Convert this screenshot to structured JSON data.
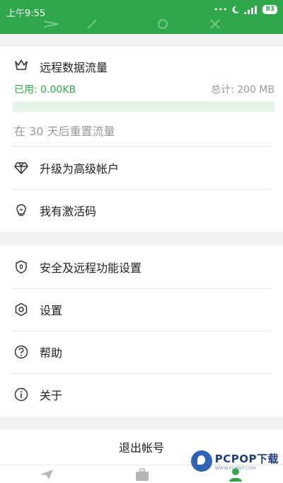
{
  "status_bar": {
    "time": "上午9:55",
    "battery": "83"
  },
  "traffic": {
    "title": "远程数据流量",
    "used": "已用: 0.00KB",
    "total": "总计: 200 MB",
    "used_fraction": 0.0,
    "reset_text": "在 30 天后重置流量"
  },
  "menu_group1": [
    {
      "label": "升级为高级帐户",
      "icon": "diamond-icon"
    },
    {
      "label": "我有激活码",
      "icon": "lightbulb-icon"
    }
  ],
  "menu_group2": [
    {
      "label": "安全及远程功能设置",
      "icon": "shield-icon"
    },
    {
      "label": "设置",
      "icon": "hexagon-settings-icon"
    },
    {
      "label": "帮助",
      "icon": "question-icon"
    },
    {
      "label": "关于",
      "icon": "info-icon"
    }
  ],
  "logout_label": "退出帐号",
  "watermark": {
    "brand": "PCPOP下载",
    "sub": "WWW.PCPOP.COM"
  },
  "colors": {
    "accent": "#2ea84a",
    "background": "#f2f2f2"
  }
}
